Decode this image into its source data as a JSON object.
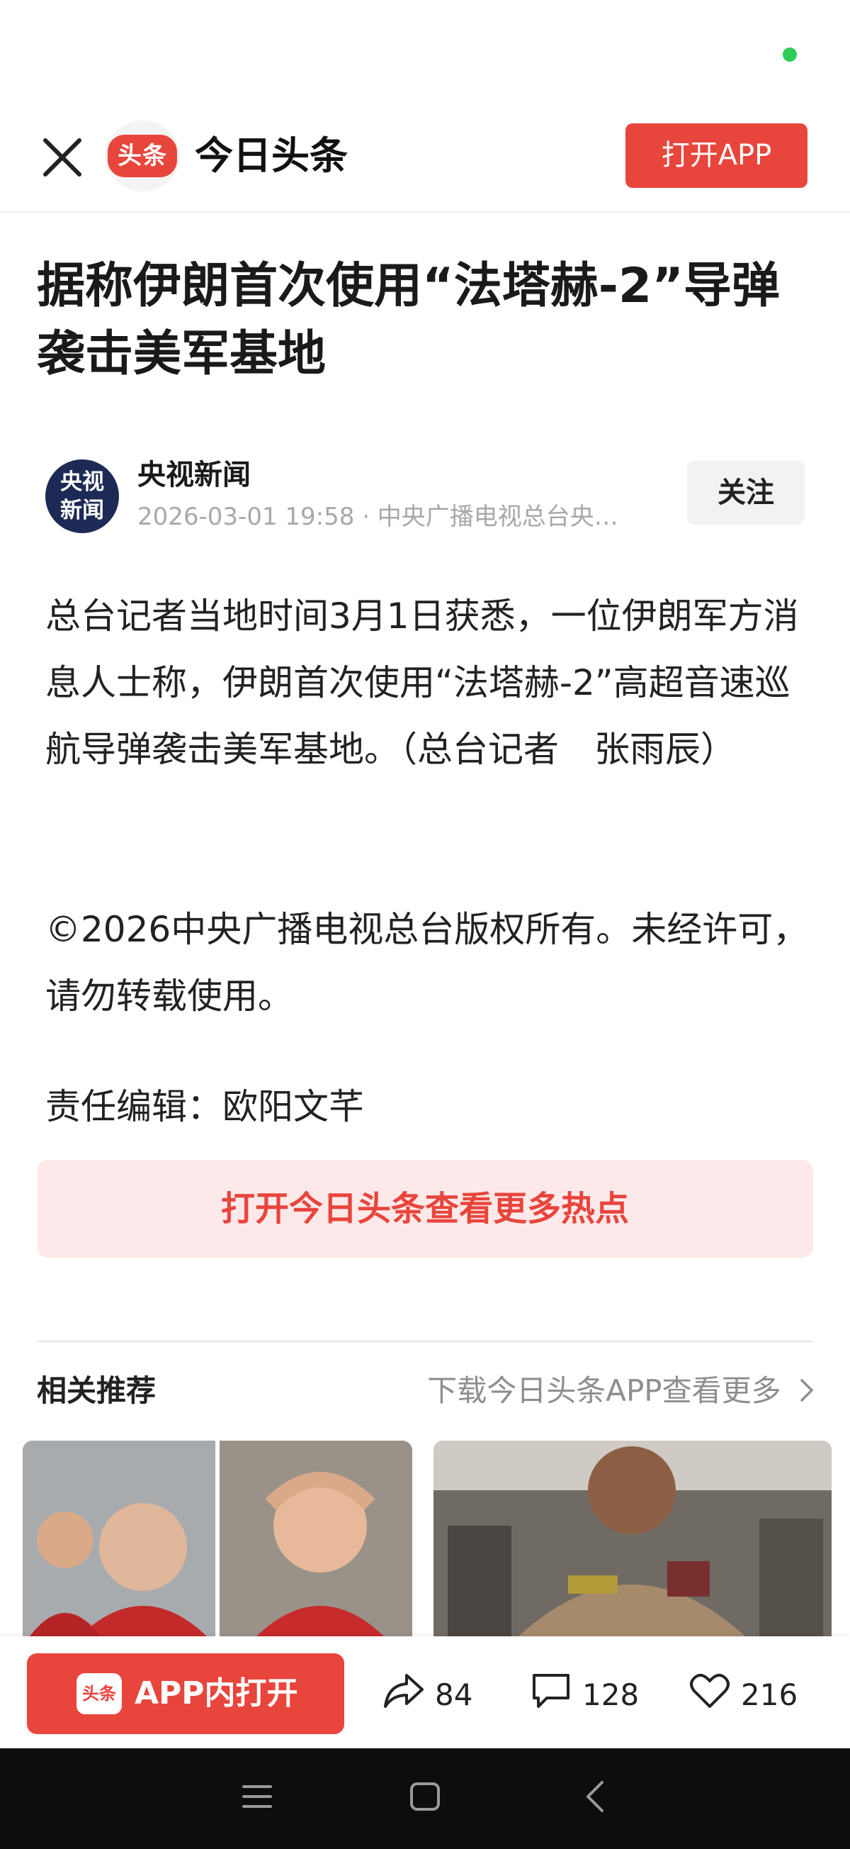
{
  "status_bar": {
    "indicator_color": "#2ecc57"
  },
  "top_bar": {
    "logo_text": "头条",
    "app_name": "今日头条",
    "open_app_label": "打开APP",
    "accent_color": "#e8453c",
    "close_icon": "close-icon"
  },
  "article": {
    "headline": "据称伊朗首次使用“法塔赫-2”导弹袭击美军基地",
    "author": {
      "avatar_text_line1": "央视",
      "avatar_text_line2": "新闻",
      "name": "央视新闻",
      "meta": "2026-03-01 19:58 · 中央广播电视总台央…",
      "follow_label": "关注"
    },
    "paragraphs": [
      "总台记者当地时间3月1日获悉，一位伊朗军方消息人士称，伊朗首次使用“法塔赫-2”高超音速巡航导弹袭击美军基地。（总台记者　张雨辰）",
      "©2026中央广播电视总台版权所有。未经许可，请勿转载使用。",
      "责任编辑：欧阳文芊"
    ],
    "cta_label": "打开今日头条查看更多热点"
  },
  "recommendations": {
    "title": "相关推荐",
    "more_label": "下载今日头条APP查看更多",
    "more_icon": "chevron-right-icon"
  },
  "bottom_bar": {
    "open_in_app_logo": "头条",
    "open_in_app_label": "APP内打开",
    "share_count": "84",
    "comment_count": "128",
    "like_count": "216"
  },
  "nav_bar": {
    "icons": [
      "menu-icon",
      "home-icon",
      "back-icon"
    ]
  }
}
